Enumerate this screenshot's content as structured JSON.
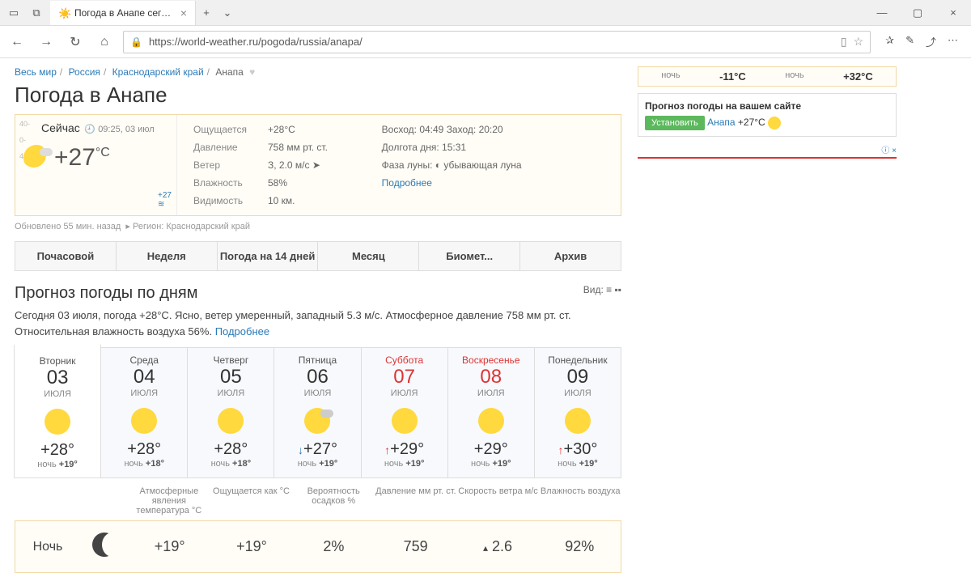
{
  "browser": {
    "tab_title": "Погода в Анапе сегодн",
    "url": "https://world-weather.ru/pogoda/russia/anapa/"
  },
  "breadcrumb": {
    "world": "Весь мир",
    "country": "Россия",
    "region": "Краснодарский край",
    "city": "Анапа"
  },
  "h1": "Погода в Анапе",
  "now": {
    "label": "Сейчас",
    "time": "09:25, 03 июл",
    "temp": "+27",
    "unit": "°C",
    "water_temp": "+27",
    "feels_lbl": "Ощущается",
    "feels": "+28°C",
    "pressure_lbl": "Давление",
    "pressure": "758 мм рт. ст.",
    "wind_lbl": "Ветер",
    "wind": "З, 2.0 м/с ➤",
    "humidity_lbl": "Влажность",
    "humidity": "58%",
    "visibility_lbl": "Видимость",
    "visibility": "10 км.",
    "sunrise_lbl": "Восход:",
    "sunrise": "04:49",
    "sunset_lbl": "Заход:",
    "sunset": "20:20",
    "daylen_lbl": "Долгота дня:",
    "daylen": "15:31",
    "moon_lbl": "Фаза луны:",
    "moon": "убывающая луна",
    "more": "Подробнее"
  },
  "updated": "Обновлено 55 мин. назад",
  "region_lbl": "Регион: Краснодарский край",
  "tabs": {
    "hourly": "Почасовой",
    "week": "Неделя",
    "d14": "Погода на 14 дней",
    "month": "Месяц",
    "bio": "Биомет...",
    "archive": "Архив"
  },
  "forecast_h2": "Прогноз погоды по дням",
  "view_lbl": "Вид:",
  "summary_text": "Сегодня 03 июля, погода +28°C. Ясно, ветер умеренный, западный 5.3 м/с. Атмосферное давление 758 мм рт. ст. Относительная влажность воздуха 56%.",
  "summary_more": "Подробнее",
  "days": [
    {
      "wd": "Вторник",
      "num": "03",
      "mon": "июля",
      "hi": "+28°",
      "lo": "ночь +19°",
      "cloudy": false,
      "arrow": "",
      "red": false
    },
    {
      "wd": "Среда",
      "num": "04",
      "mon": "июля",
      "hi": "+28°",
      "lo": "ночь +18°",
      "cloudy": false,
      "arrow": "",
      "red": false
    },
    {
      "wd": "Четверг",
      "num": "05",
      "mon": "июля",
      "hi": "+28°",
      "lo": "ночь +18°",
      "cloudy": false,
      "arrow": "",
      "red": false
    },
    {
      "wd": "Пятница",
      "num": "06",
      "mon": "июля",
      "hi": "+27°",
      "lo": "ночь +19°",
      "cloudy": true,
      "arrow": "down",
      "red": false
    },
    {
      "wd": "Суббота",
      "num": "07",
      "mon": "июля",
      "hi": "+29°",
      "lo": "ночь +19°",
      "cloudy": false,
      "arrow": "up",
      "red": true
    },
    {
      "wd": "Воскресенье",
      "num": "08",
      "mon": "июля",
      "hi": "+29°",
      "lo": "ночь +19°",
      "cloudy": false,
      "arrow": "",
      "red": true
    },
    {
      "wd": "Понедельник",
      "num": "09",
      "mon": "июля",
      "hi": "+30°",
      "lo": "ночь +19°",
      "cloudy": false,
      "arrow": "up",
      "red": false
    }
  ],
  "detail_headers": {
    "atm": "Атмосферные явления температура °C",
    "feels": "Ощущается как °C",
    "precip": "Вероятность осадков %",
    "press": "Давление мм рт. ст.",
    "wind": "Скорость ветра м/с",
    "hum": "Влажность воздуха"
  },
  "detail_row": {
    "time": "Ночь",
    "temp": "+19°",
    "feels": "+19°",
    "precip": "2%",
    "press": "759",
    "wind": "2.6",
    "hum": "92%"
  },
  "side": {
    "night_lbl": "ночь",
    "cold": "-11°C",
    "hot": "+32°C",
    "widget_title": "Прогноз погоды на вашем сайте",
    "install": "Установить",
    "city": "Анапа",
    "temp": "+27°C"
  }
}
